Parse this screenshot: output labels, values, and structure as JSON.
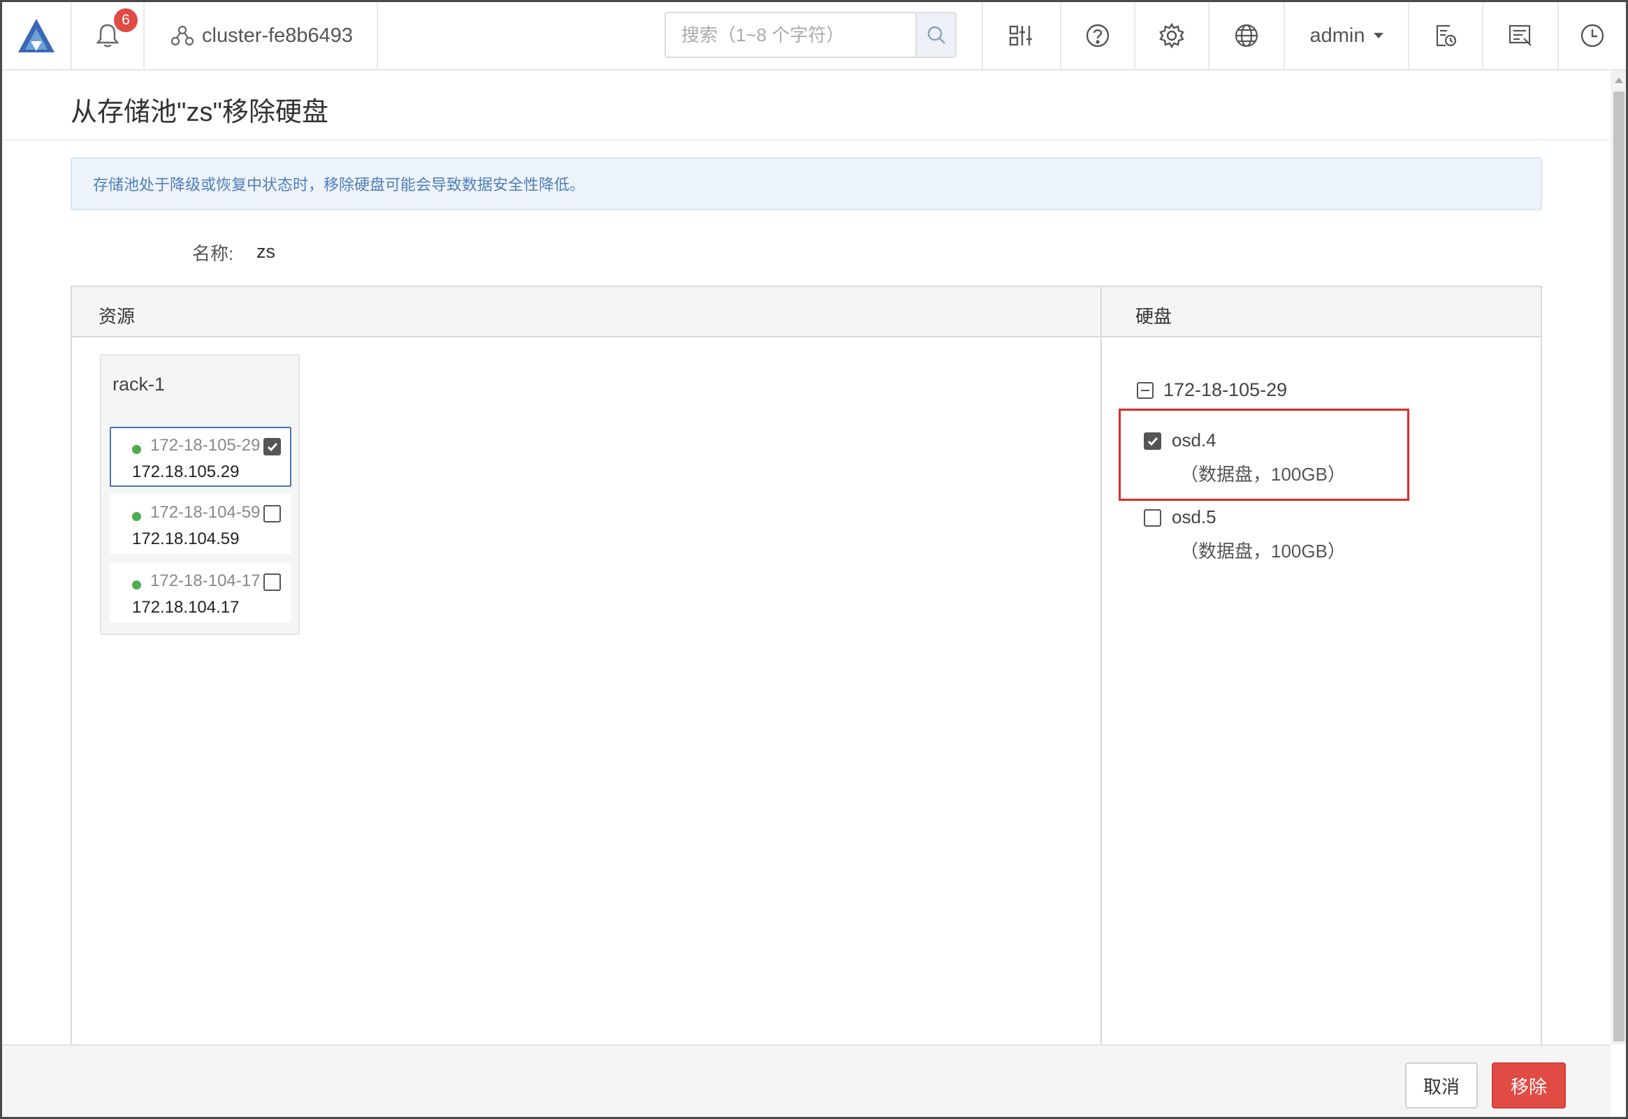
{
  "topbar": {
    "notification_count": "6",
    "cluster_name": "cluster-fe8b6493",
    "search_placeholder": "搜索（1~8 个字符）",
    "user_name": "admin"
  },
  "dialog": {
    "title": "从存储池\"zs\"移除硬盘",
    "alert_text": "存储池处于降级或恢复中状态时，移除硬盘可能会导致数据安全性降低。",
    "name_label": "名称:",
    "name_value": "zs"
  },
  "resources": {
    "header": "资源",
    "rack": {
      "title": "rack-1",
      "hosts": [
        {
          "name": "172-18-105-29",
          "ip": "172.18.105.29",
          "checked": true,
          "selected": true,
          "status_color": "#4cae4c"
        },
        {
          "name": "172-18-104-59",
          "ip": "172.18.104.59",
          "checked": false,
          "selected": false,
          "status_color": "#4cae4c"
        },
        {
          "name": "172-18-104-17",
          "ip": "172.18.104.17",
          "checked": false,
          "selected": false,
          "status_color": "#4cae4c"
        }
      ]
    }
  },
  "disks": {
    "header": "硬盘",
    "host": "172-18-105-29",
    "items": [
      {
        "name": "osd.4",
        "desc": "（数据盘，100GB）",
        "checked": true
      },
      {
        "name": "osd.5",
        "desc": "（数据盘，100GB）",
        "checked": false
      }
    ]
  },
  "footer": {
    "cancel_label": "取消",
    "remove_label": "移除"
  },
  "colors": {
    "danger": "#e04b44",
    "info_text": "#4f7fb8",
    "online": "#4cae4c",
    "highlight_box": "#e02b2b"
  }
}
